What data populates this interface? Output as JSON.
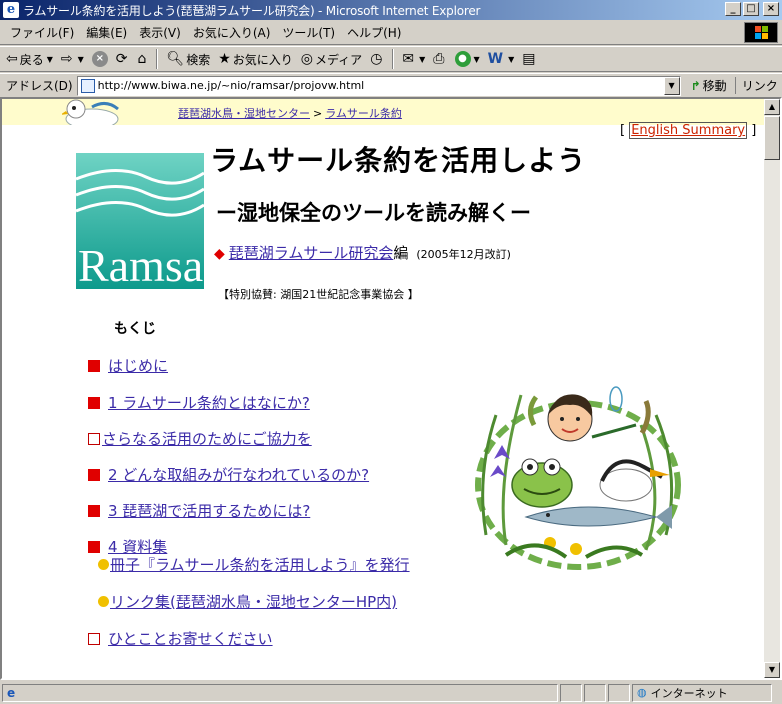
{
  "window": {
    "title": "ラムサール条約を活用しよう(琵琶湖ラムサール研究会) - Microsoft Internet Explorer"
  },
  "menu": [
    "ファイル(F)",
    "編集(E)",
    "表示(V)",
    "お気に入り(A)",
    "ツール(T)",
    "ヘルプ(H)"
  ],
  "toolbar": {
    "back": "戻る",
    "search": "検索",
    "favorites": "お気に入り",
    "media": "メディア"
  },
  "address": {
    "label": "アドレス(D)",
    "url": "http://www.biwa.ne.jp/~nio/ramsar/projovw.html",
    "go": "移動",
    "links": "リンク"
  },
  "page": {
    "breadcrumb": [
      "琵琶湖水鳥・湿地センター",
      "ラムサール条約"
    ],
    "breadcrumb_sep": ">",
    "english_link": "English Summary",
    "logo_text": "Ramsar",
    "title": "ラムサール条約を活用しよう",
    "subtitle": "ー湿地保全のツールを読み解くー",
    "author_link": "琵琶湖ラムサール研究会",
    "author_suffix": "編",
    "revision": "(2005年12月改訂)",
    "sponsor": "【特別協賛: 湖国21世紀記念事業協会 】",
    "toc_heading": "もくじ",
    "toc": [
      "はじめに",
      "1 ラムサール条約とはなにか?",
      "さらなる活用のためにご協力を",
      "2 どんな取組みが行なわれているのか?",
      "3 琵琶湖で活用するためには?",
      "4 資料集",
      "冊子『ラムサール条約を活用しよう』を発行",
      "リンク集(琵琶湖水鳥・湿地センターHP内)",
      "ひとことお寄せください"
    ]
  },
  "status": {
    "zone": "インターネット"
  },
  "colors": {
    "title_bar": "#0a246a",
    "link": "#3b2ba8",
    "bullet_red": "#e00000",
    "bullet_gold": "#f0c000",
    "strip": "#fffccc",
    "logo_teal": "#1aa79a"
  }
}
